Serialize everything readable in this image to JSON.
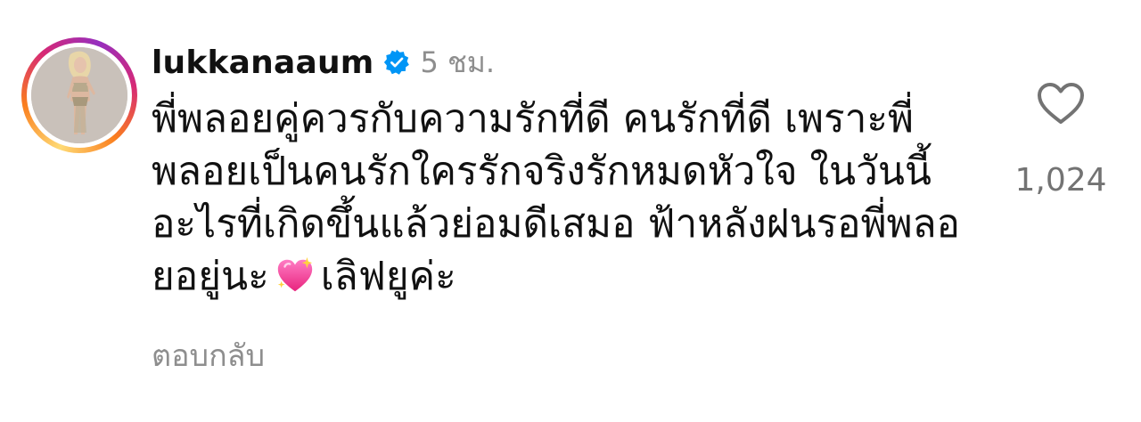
{
  "comment": {
    "username": "lukkanaaum",
    "verified_icon": "verified-badge-icon",
    "timestamp": "5 ชม.",
    "text_lines": [
      "พี่พลอยคู่ควรกับความรักที่ดี คนรักที่ดี เพราะพี่",
      "พลอยเป็นคนรักใครรักจริงรักหมดหัวใจ ในวันนี้",
      "อะไรที่เกิดขึ้นแล้วย่อมดีเสมอ ฟ้าหลังฝนรอพี่พลอ",
      "ยอยู่นะ"
    ],
    "text_tail": "เลิฟยูค่ะ",
    "emoji": "sparkling-heart-icon",
    "reply_label": "ตอบกลับ",
    "like_icon": "heart-outline-icon",
    "like_count": "1,024"
  },
  "colors": {
    "text": "#111111",
    "muted": "#8e8e8e",
    "verified": "#0095f6",
    "emoji_pink": "#ff4fa3"
  }
}
